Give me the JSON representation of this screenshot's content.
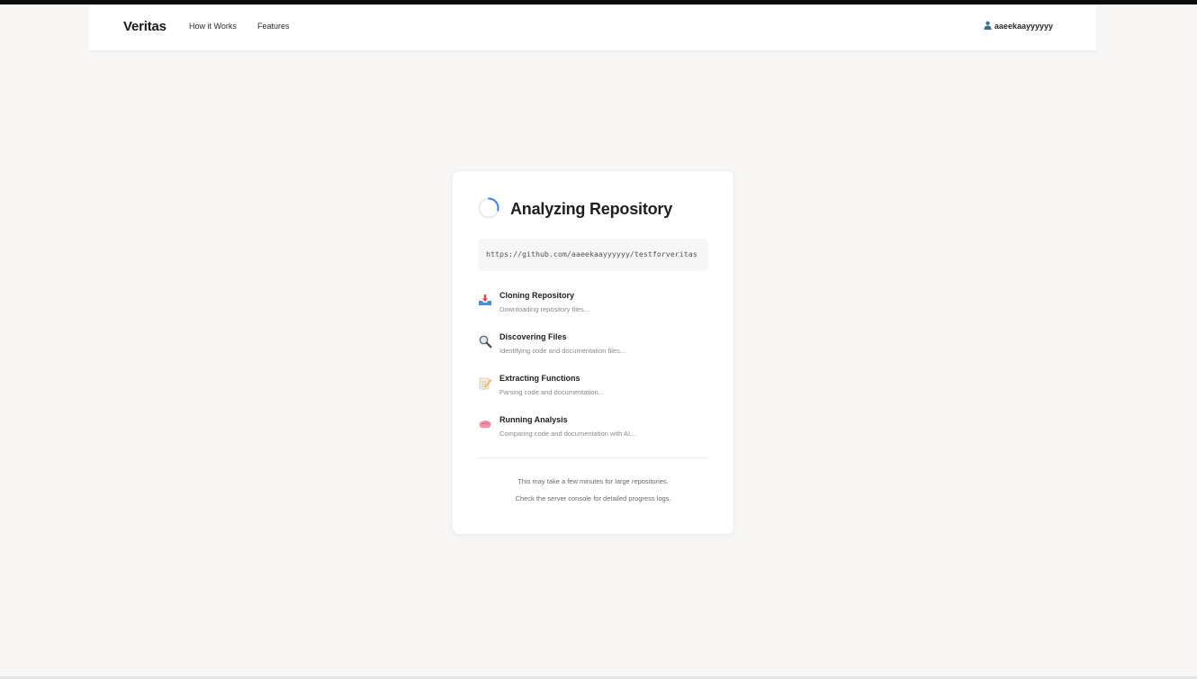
{
  "nav": {
    "brand": "Veritas",
    "links": [
      {
        "label": "How it Works"
      },
      {
        "label": "Features"
      }
    ],
    "user": {
      "name": "aaeekaayyyyyy",
      "icon": "user-icon"
    }
  },
  "card": {
    "title": "Analyzing Repository",
    "spinner": {
      "icon": "spinner-icon",
      "color": "#3b82f6"
    },
    "repo_url": "https://github.com/aaeekaayyyyyy/testforveritas",
    "steps": [
      {
        "icon": "inbox-tray-icon",
        "title": "Cloning Repository",
        "description": "Downloading repository files..."
      },
      {
        "icon": "magnifier-icon",
        "title": "Discovering Files",
        "description": "Identifying code and documentation files..."
      },
      {
        "icon": "memo-icon",
        "title": "Extracting Functions",
        "description": "Parsing code and documentation..."
      },
      {
        "icon": "brain-icon",
        "title": "Running Analysis",
        "description": "Comparing code and documentation with AI..."
      }
    ],
    "notes": [
      "This may take a few minutes for large repositories.",
      "Check the server console for detailed progress logs."
    ]
  },
  "colors": {
    "background": "#f8f7f5",
    "card": "#ffffff",
    "accent": "#3b82f6"
  }
}
